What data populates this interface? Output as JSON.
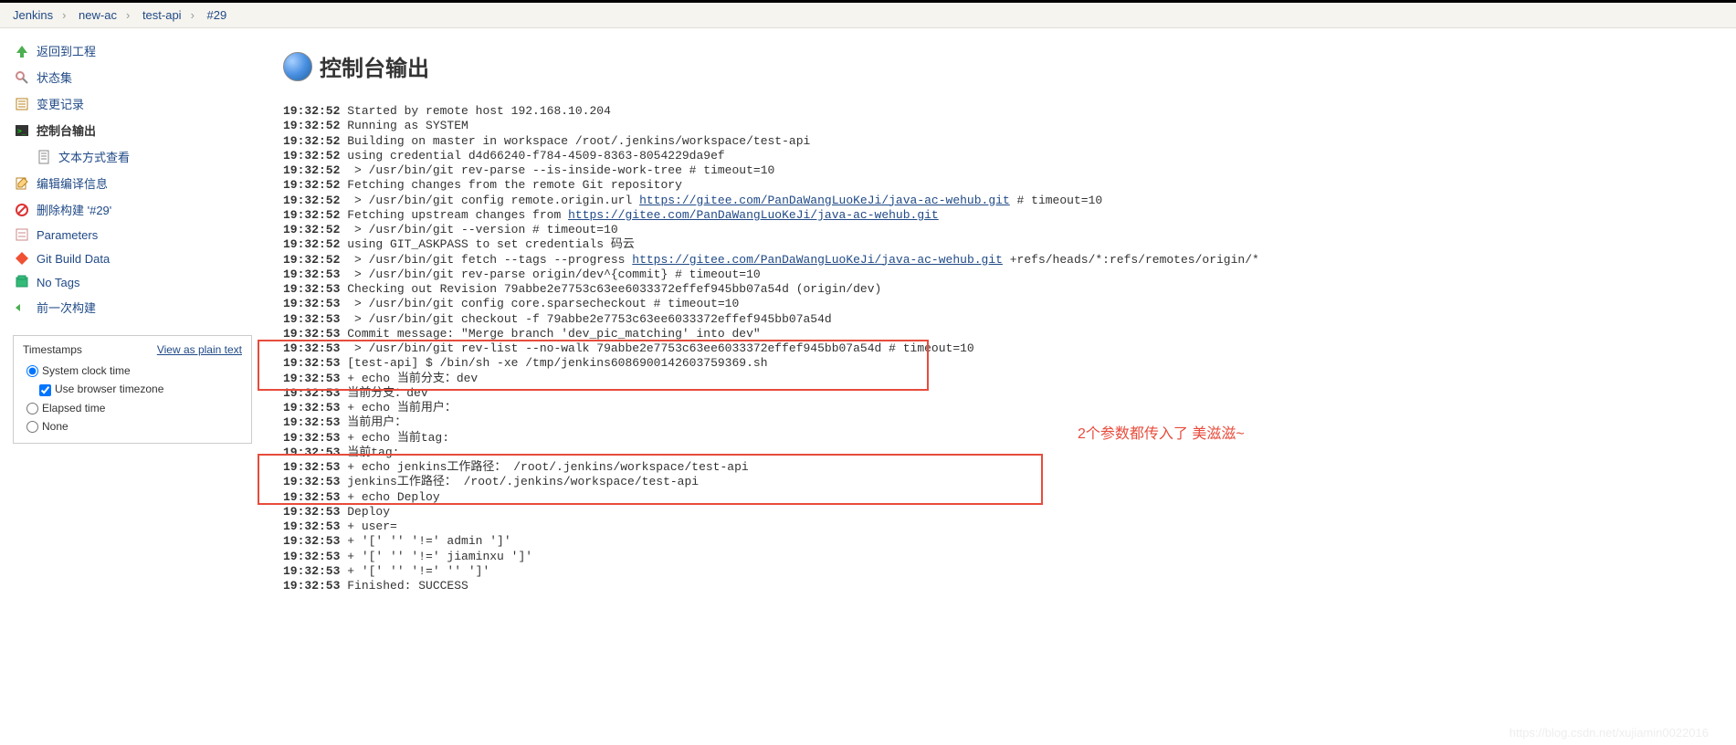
{
  "breadcrumb": [
    {
      "label": "Jenkins"
    },
    {
      "label": "new-ac"
    },
    {
      "label": "test-api"
    },
    {
      "label": "#29"
    }
  ],
  "sidebar": {
    "items": [
      {
        "label": "返回到工程",
        "icon": "up-arrow"
      },
      {
        "label": "状态集",
        "icon": "search"
      },
      {
        "label": "变更记录",
        "icon": "changes"
      },
      {
        "label": "控制台输出",
        "icon": "terminal",
        "active": true
      },
      {
        "label": "文本方式查看",
        "icon": "text",
        "sub": true
      },
      {
        "label": "编辑编译信息",
        "icon": "edit"
      },
      {
        "label": "删除构建 '#29'",
        "icon": "delete"
      },
      {
        "label": "Parameters",
        "icon": "params"
      },
      {
        "label": "Git Build Data",
        "icon": "git"
      },
      {
        "label": "No Tags",
        "icon": "notags"
      },
      {
        "label": "前一次构建",
        "icon": "prev"
      }
    ]
  },
  "panel": {
    "title": "Timestamps",
    "link": "View as plain text",
    "opts": {
      "system": "System clock time",
      "browser": "Use browser timezone",
      "elapsed": "Elapsed time",
      "none": "None"
    }
  },
  "page": {
    "title": "控制台输出"
  },
  "console": {
    "url1": "https://gitee.com/PanDaWangLuoKeJi/java-ac-wehub.git",
    "lines": [
      {
        "ts": "19:32:52",
        "txt": "Started by remote host 192.168.10.204"
      },
      {
        "ts": "19:32:52",
        "txt": "Running as SYSTEM"
      },
      {
        "ts": "19:32:52",
        "txt": "Building on master in workspace /root/.jenkins/workspace/test-api"
      },
      {
        "ts": "19:32:52",
        "txt": "using credential d4d66240-f784-4509-8363-8054229da9ef"
      },
      {
        "ts": "19:32:52",
        "txt": " > /usr/bin/git rev-parse --is-inside-work-tree # timeout=10"
      },
      {
        "ts": "19:32:52",
        "txt": "Fetching changes from the remote Git repository"
      },
      {
        "ts": "19:32:52",
        "pre": " > /usr/bin/git config remote.origin.url ",
        "url": "https://gitee.com/PanDaWangLuoKeJi/java-ac-wehub.git",
        "post": " # timeout=10"
      },
      {
        "ts": "19:32:52",
        "pre": "Fetching upstream changes from ",
        "url": "https://gitee.com/PanDaWangLuoKeJi/java-ac-wehub.git",
        "post": ""
      },
      {
        "ts": "19:32:52",
        "txt": " > /usr/bin/git --version # timeout=10"
      },
      {
        "ts": "19:32:52",
        "txt": "using GIT_ASKPASS to set credentials 码云"
      },
      {
        "ts": "19:32:52",
        "pre": " > /usr/bin/git fetch --tags --progress ",
        "url": "https://gitee.com/PanDaWangLuoKeJi/java-ac-wehub.git",
        "post": " +refs/heads/*:refs/remotes/origin/*"
      },
      {
        "ts": "19:32:53",
        "txt": " > /usr/bin/git rev-parse origin/dev^{commit} # timeout=10"
      },
      {
        "ts": "19:32:53",
        "txt": "Checking out Revision 79abbe2e7753c63ee6033372effef945bb07a54d (origin/dev)"
      },
      {
        "ts": "19:32:53",
        "txt": " > /usr/bin/git config core.sparsecheckout # timeout=10"
      },
      {
        "ts": "19:32:53",
        "txt": " > /usr/bin/git checkout -f 79abbe2e7753c63ee6033372effef945bb07a54d"
      },
      {
        "ts": "19:32:53",
        "txt": "Commit message: \"Merge branch 'dev_pic_matching' into dev\""
      },
      {
        "ts": "19:32:53",
        "txt": " > /usr/bin/git rev-list --no-walk 79abbe2e7753c63ee6033372effef945bb07a54d # timeout=10"
      },
      {
        "ts": "19:32:53",
        "txt": "[test-api] $ /bin/sh -xe /tmp/jenkins6086900142603759369.sh"
      },
      {
        "ts": "19:32:53",
        "txt": "+ echo 当前分支：dev"
      },
      {
        "ts": "19:32:53",
        "txt": "当前分支：dev"
      },
      {
        "ts": "19:32:53",
        "txt": "+ echo 当前用户："
      },
      {
        "ts": "19:32:53",
        "txt": "当前用户："
      },
      {
        "ts": "19:32:53",
        "txt": "+ echo 当前tag:"
      },
      {
        "ts": "19:32:53",
        "txt": "当前tag:"
      },
      {
        "ts": "19:32:53",
        "txt": "+ echo jenkins工作路径： /root/.jenkins/workspace/test-api"
      },
      {
        "ts": "19:32:53",
        "txt": "jenkins工作路径： /root/.jenkins/workspace/test-api"
      },
      {
        "ts": "19:32:53",
        "txt": "+ echo Deploy"
      },
      {
        "ts": "19:32:53",
        "txt": "Deploy"
      },
      {
        "ts": "19:32:53",
        "txt": "+ user="
      },
      {
        "ts": "19:32:53",
        "txt": "+ '[' '' '!=' admin ']'"
      },
      {
        "ts": "19:32:53",
        "txt": "+ '[' '' '!=' jiaminxu ']'"
      },
      {
        "ts": "19:32:53",
        "txt": "+ '[' '' '!=' '' ']'"
      },
      {
        "ts": "19:32:53",
        "txt": "Finished: SUCCESS"
      }
    ]
  },
  "annotation": "2个参数都传入了 美滋滋~",
  "watermark": "https://blog.csdn.net/xujiamin0022016"
}
